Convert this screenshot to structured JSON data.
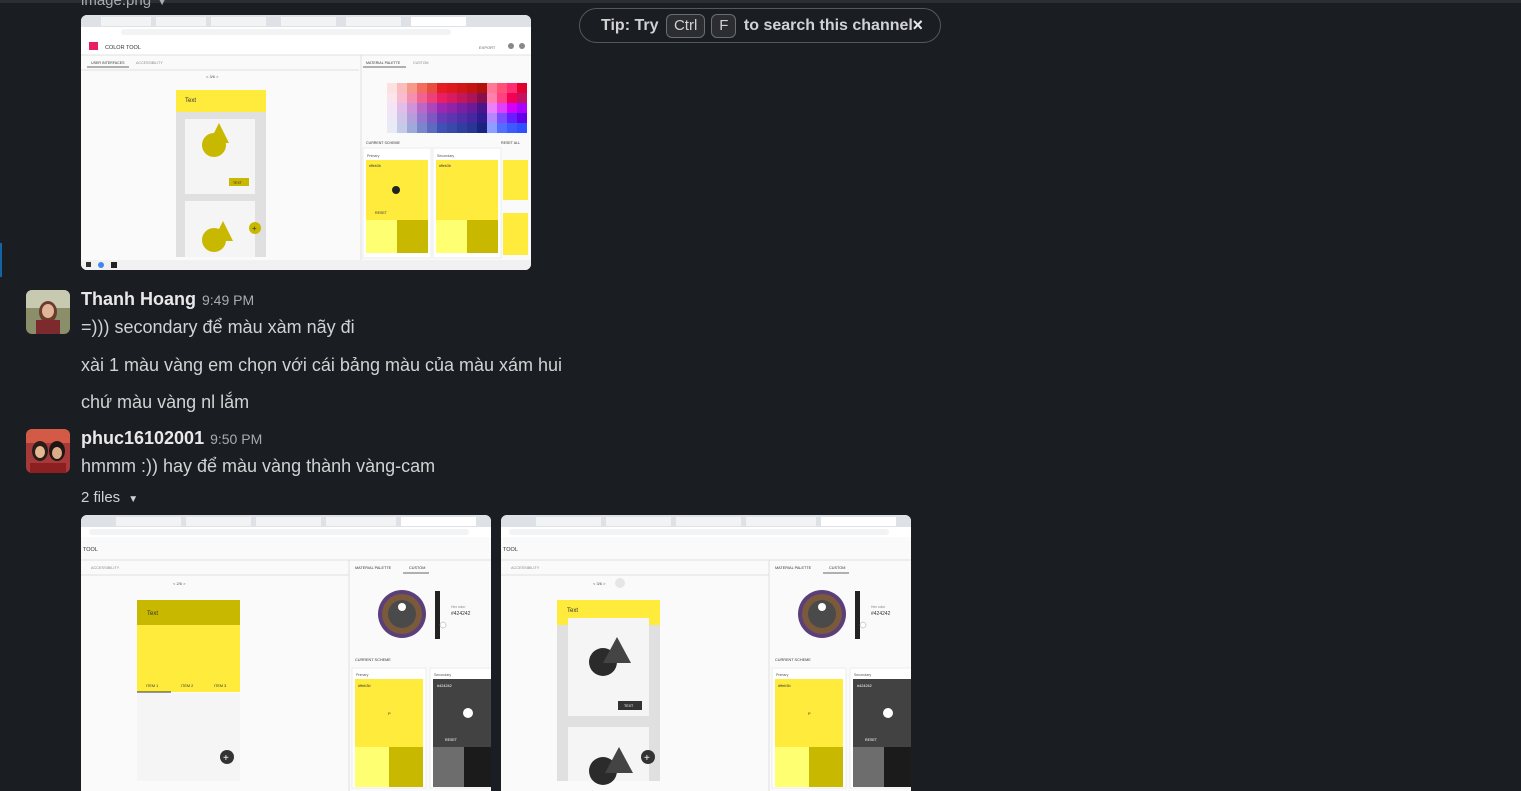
{
  "top_attachment": {
    "filename": "image.png"
  },
  "tip": {
    "prefix": "Tip: Try",
    "key1": "Ctrl",
    "key2": "F",
    "suffix": "to search this channel",
    "close": "×"
  },
  "messages": [
    {
      "author": "Thanh Hoang",
      "time": "9:49 PM",
      "lines": [
        "=))) secondary để màu xàm nãy đi",
        "xài 1 màu vàng em chọn với cái bảng màu của màu xám hui",
        "chứ màu vàng nl lắm"
      ]
    },
    {
      "author": "phuc16102001",
      "time": "9:50 PM",
      "lines": [
        "hmmm :)) hay để màu vàng thành vàng-cam"
      ],
      "files_label": "2 files"
    }
  ],
  "screenshot1": {
    "app_title": "COLOR TOOL",
    "tab1": "USER INTERFACES",
    "tab2": "ACCESSIBILITY",
    "tab3": "MATERIAL PALETTE",
    "tab4": "CUSTOM",
    "pager": "< 3/6 >",
    "text_label": "Text",
    "text_btn": "TEXT",
    "current_scheme": "CURRENT SCHEME",
    "reset_all": "RESET ALL",
    "primary": "Primary",
    "secondary": "Secondary",
    "primary_hex": "#ffeb3b",
    "secondary_hex": "#ffeb3b",
    "reset": "RESET",
    "export": "EXPORT"
  },
  "screenshot2": {
    "tool": "TOOL",
    "tab_acc": "ACCESSIBILITY",
    "tab_mp": "MATERIAL PALETTE",
    "tab_custom": "CUSTOM",
    "pager": "< 2/6 >",
    "text_label": "Text",
    "item1": "ITEM 1",
    "item2": "ITEM 2",
    "item3": "ITEM 3",
    "hex_label": "Hex color",
    "hex_value": "#424242",
    "current_scheme": "CURRENT SCHEME",
    "primary": "Primary",
    "secondary": "Secondary",
    "primary_hex": "#ffeb3b",
    "secondary_hex": "#424242",
    "reset": "RESET"
  },
  "screenshot3": {
    "tool": "TOOL",
    "tab_acc": "ACCESSIBILITY",
    "tab_mp": "MATERIAL PALETTE",
    "tab_custom": "CUSTOM",
    "pager": "< 3/6 >",
    "text_label": "Text",
    "text_btn": "TEXT",
    "hex_label": "Hex color",
    "hex_value": "#424242",
    "current_scheme": "CURRENT SCHEME",
    "primary": "Primary",
    "secondary": "Secondary",
    "primary_hex": "#ffeb3b",
    "secondary_hex": "#424242",
    "reset": "RESET"
  },
  "colors": {
    "background": "#1a1d21",
    "text": "#d1d2d3",
    "yellow": "#ffeb3b",
    "dark_yellow": "#c9b800",
    "grey": "#424242"
  }
}
